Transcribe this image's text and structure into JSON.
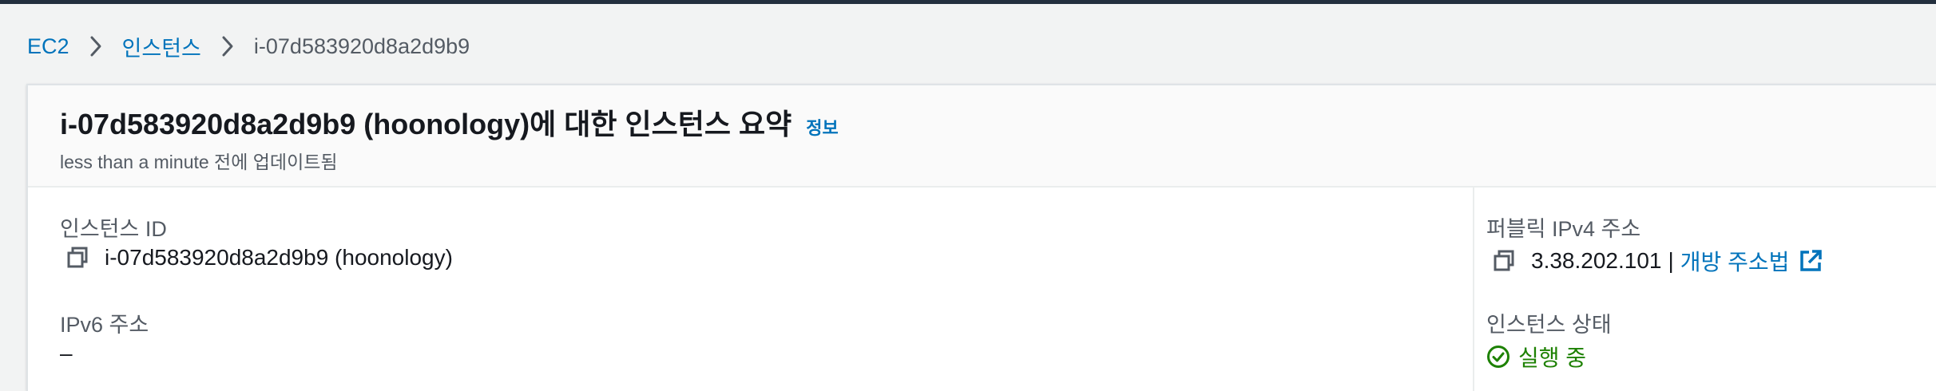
{
  "breadcrumb": {
    "items": [
      {
        "label": "EC2"
      },
      {
        "label": "인스턴스"
      },
      {
        "label": "i-07d583920d8a2d9b9"
      }
    ]
  },
  "summary": {
    "title": "i-07d583920d8a2d9b9 (hoonology)에 대한 인스턴스 요약",
    "info_link": "정보",
    "updated": "less than a minute 전에 업데이트됨"
  },
  "fields": {
    "instance_id": {
      "label": "인스턴스 ID",
      "value": "i-07d583920d8a2d9b9 (hoonology)"
    },
    "ipv6": {
      "label": "IPv6 주소",
      "value": "–"
    },
    "public_ipv4": {
      "label": "퍼블릭 IPv4 주소",
      "value": "3.38.202.101",
      "separator": "|",
      "link_label": "개방 주소법"
    },
    "instance_state": {
      "label": "인스턴스 상태",
      "value": "실행 중"
    }
  },
  "colors": {
    "link": "#0073bb",
    "running": "#1d8102",
    "topbar": "#232f3e"
  },
  "icons": {
    "copy": "copy-icon",
    "external": "external-link-icon",
    "status": "check-circle-icon",
    "separator": "chevron-right-icon"
  }
}
